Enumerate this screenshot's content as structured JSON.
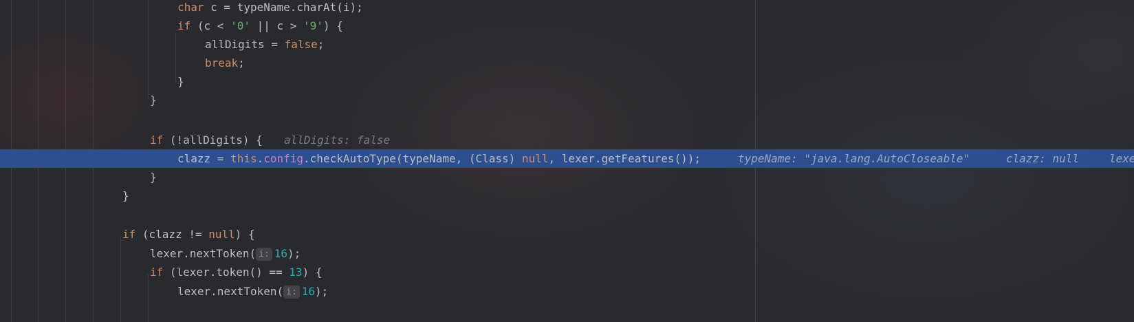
{
  "colors": {
    "background": "#292a2e",
    "current_line": "#2e4f8f",
    "keyword": "#cf8e6d",
    "string": "#6aab73",
    "number": "#2aacb8",
    "field": "#c77dbb",
    "inline_hint": "#7a7e85",
    "text": "#bcbec4"
  },
  "code": {
    "l1": {
      "kw": "char",
      "rest": " c = typeName.charAt(i);"
    },
    "l2": {
      "kw": "if",
      "a": " (c < ",
      "s1": "'0'",
      "b": " || c > ",
      "s2": "'9'",
      "c": ") {"
    },
    "l3": {
      "a": "allDigits = ",
      "kw": "false",
      "b": ";"
    },
    "l4": {
      "kw": "break",
      "b": ";"
    },
    "l5": {
      "text": "}"
    },
    "l6": {
      "text": "}"
    },
    "l8": {
      "kw": "if",
      "a": " (!allDigits) {",
      "hint": "allDigits: false"
    },
    "l9": {
      "a": "clazz = ",
      "kw_this": "this",
      "dot": ".",
      "field": "config",
      "b": ".checkAutoType(typeName, (Class) ",
      "kw_null": "null",
      "c": ", lexer.getFeatures());",
      "hint1": "typeName: \"java.lang.AutoCloseable\"",
      "hint2": "clazz: null",
      "hint3": "lexe"
    },
    "l10": {
      "text": "}"
    },
    "l11": {
      "text": "}"
    },
    "l13": {
      "kw": "if",
      "a": " (clazz != ",
      "kw_null": "null",
      "b": ") {"
    },
    "l14": {
      "a": "lexer.nextToken(",
      "param": "i:",
      "num": "16",
      "b": ");"
    },
    "l15": {
      "kw": "if",
      "a": " (lexer.token() == ",
      "num": "13",
      "b": ") {"
    },
    "l16": {
      "a": "lexer.nextToken(",
      "param": "i:",
      "num": "16",
      "b": ");"
    }
  }
}
